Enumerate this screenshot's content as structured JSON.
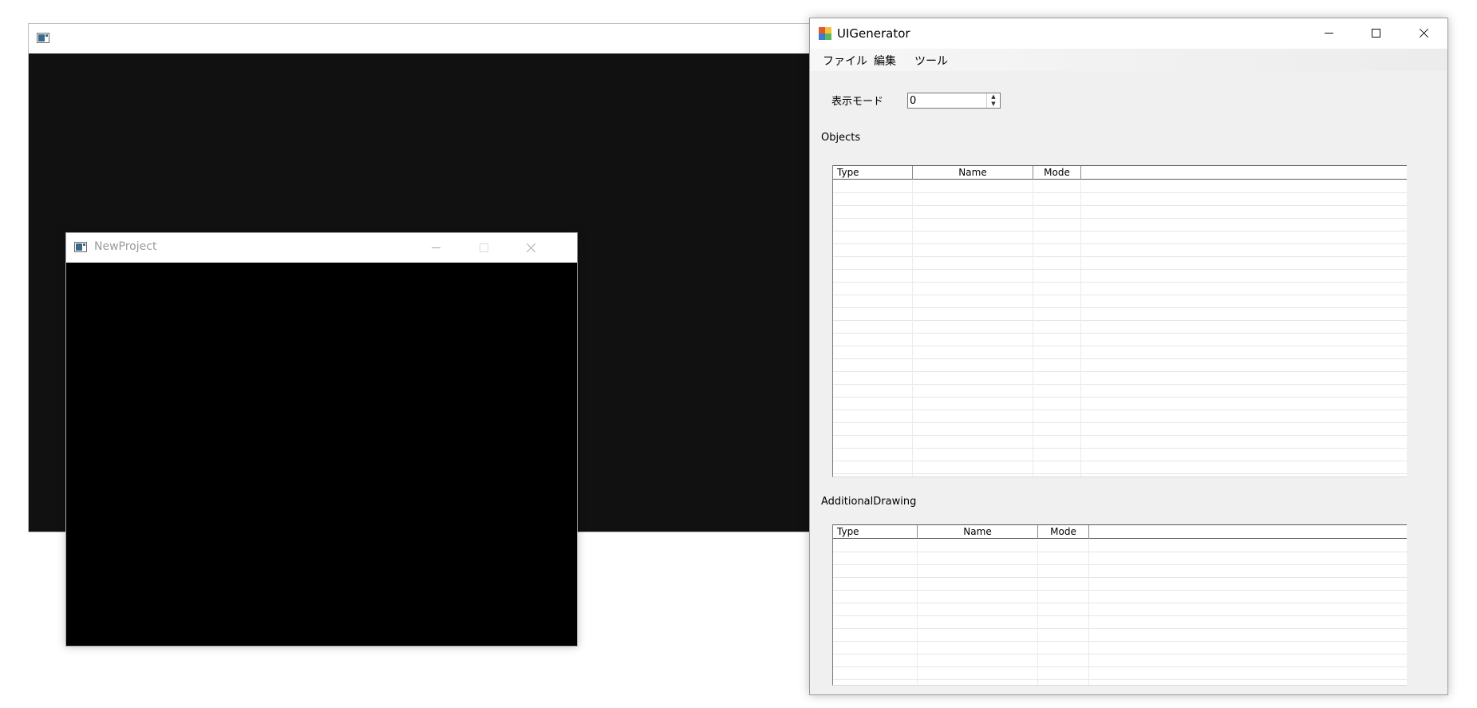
{
  "new_project_window": {
    "title": "NewProject"
  },
  "ui_generator": {
    "title": "UIGenerator",
    "menu": [
      "ファイル",
      "編集",
      "ツール"
    ],
    "display_mode": {
      "label": "表示モード",
      "value": "0"
    },
    "objects": {
      "label": "Objects",
      "columns": [
        "Type",
        "Name",
        "Mode"
      ],
      "rows": []
    },
    "additional_drawing": {
      "label": "AdditionalDrawing",
      "columns": [
        "Type",
        "Name",
        "Mode"
      ],
      "rows": []
    }
  },
  "colors": {
    "console_background": "#111111",
    "project_background": "#000000",
    "form_background": "#f0f0f0"
  }
}
